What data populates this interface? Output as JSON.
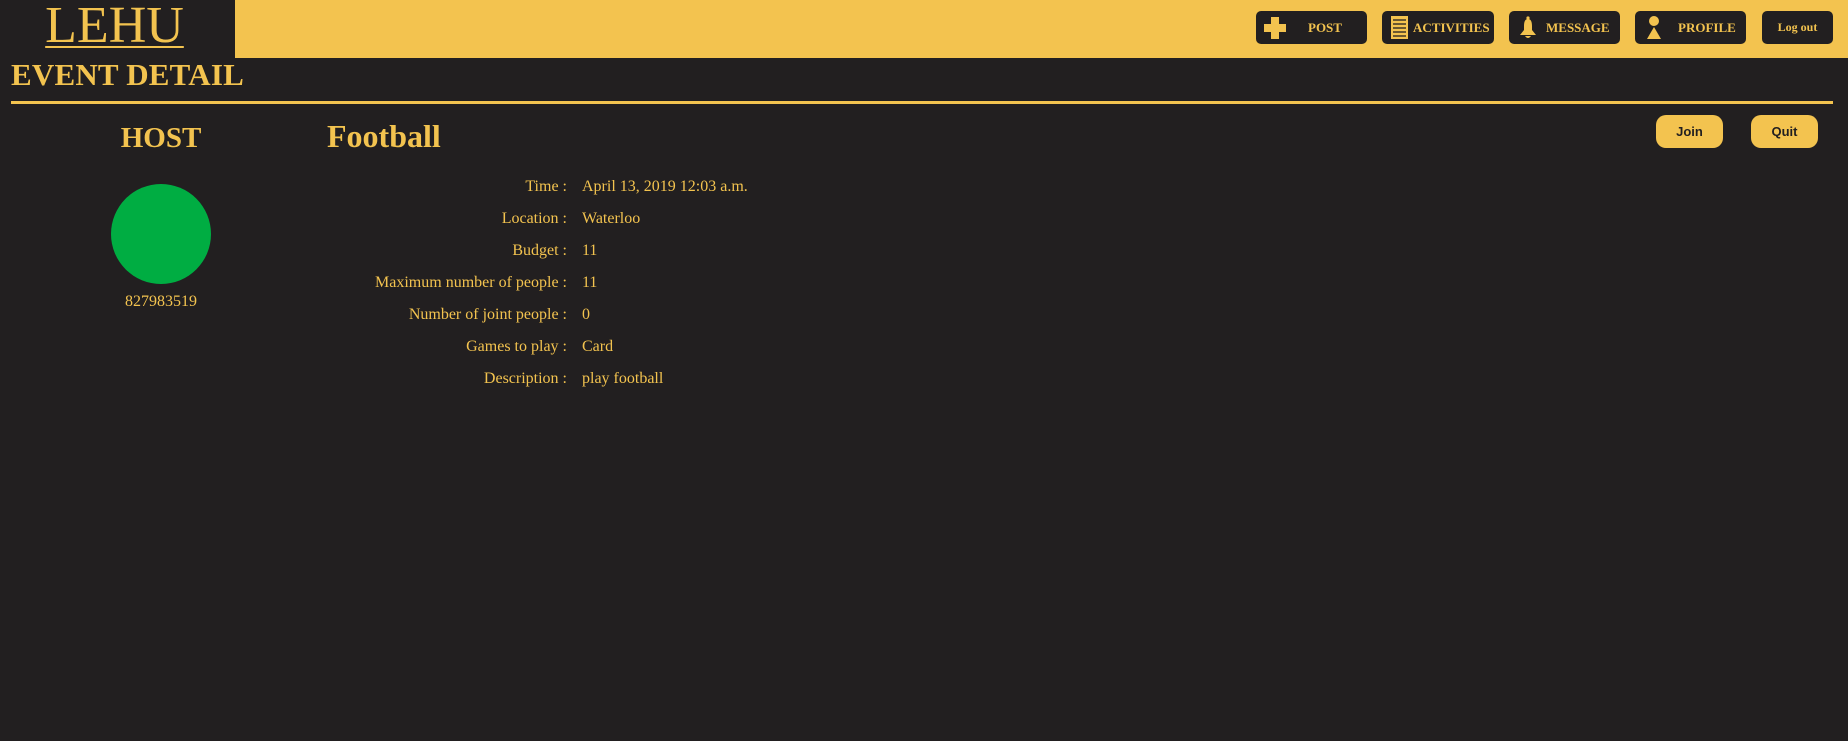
{
  "app": {
    "logo": "LEHU"
  },
  "nav": {
    "post": {
      "label": "POST",
      "icon": "plus-icon"
    },
    "activities": {
      "label": "ACTIVITIES",
      "icon": "list-icon"
    },
    "message": {
      "label": "MESSAGE",
      "icon": "bell-icon"
    },
    "profile": {
      "label": "PROFILE",
      "icon": "person-icon"
    },
    "logout": {
      "label": "Log out"
    }
  },
  "page": {
    "title": "EVENT DETAIL"
  },
  "host": {
    "heading": "HOST",
    "avatar_color": "#00ad42",
    "id": "827983519"
  },
  "event": {
    "title": "Football",
    "join_label": "Join",
    "quit_label": "Quit",
    "details": [
      {
        "label": "Time :",
        "value": "April 13, 2019 12:03 a.m."
      },
      {
        "label": "Location :",
        "value": "Waterloo"
      },
      {
        "label": "Budget :",
        "value": "11"
      },
      {
        "label": "Maximum number of people :",
        "value": "11"
      },
      {
        "label": "Number of joint people :",
        "value": "0"
      },
      {
        "label": "Games to play :",
        "value": "Card"
      },
      {
        "label": "Description :",
        "value": "play football"
      }
    ]
  },
  "colors": {
    "background": "#221f20",
    "accent": "#f3c34f",
    "avatar": "#00ad42"
  }
}
